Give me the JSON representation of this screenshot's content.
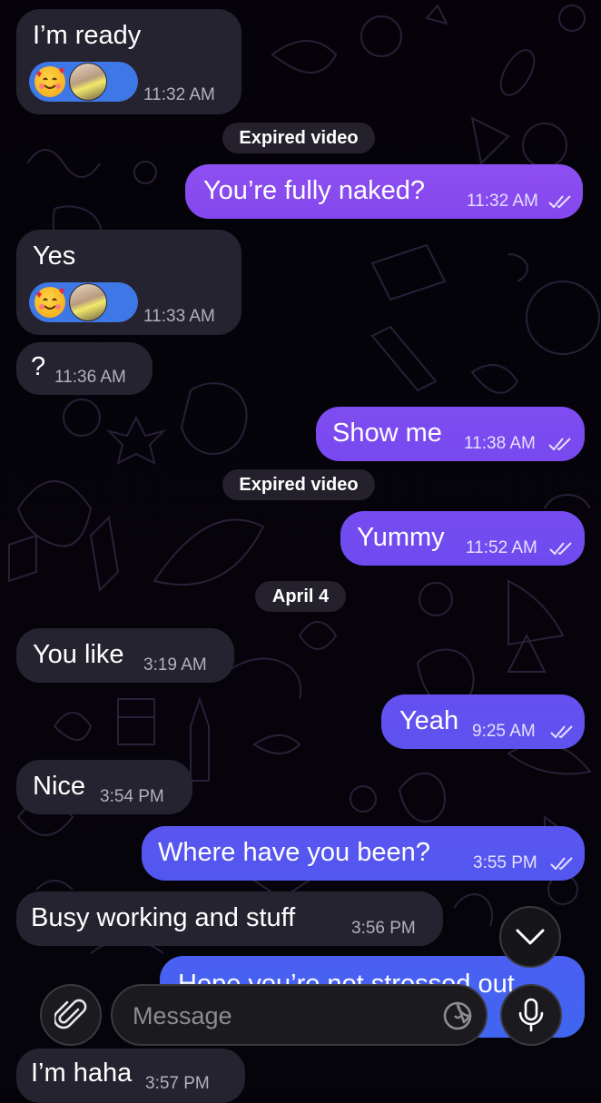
{
  "chat": {
    "messages": [
      {
        "id": "m1",
        "dir": "in",
        "text": "I’m ready",
        "time": "11:32 AM",
        "reactions": [
          "smiling-face-with-hearts",
          "sender-avatar"
        ]
      },
      {
        "id": "s1",
        "type": "service",
        "text": "Expired video"
      },
      {
        "id": "m2",
        "dir": "out",
        "text": "You’re fully naked?",
        "time": "11:32 AM",
        "read": true
      },
      {
        "id": "m3",
        "dir": "in",
        "text": "Yes",
        "time": "11:33 AM",
        "reactions": [
          "smiling-face-with-hearts",
          "sender-avatar"
        ]
      },
      {
        "id": "m4",
        "dir": "in",
        "text": "?",
        "time": "11:36 AM"
      },
      {
        "id": "m5",
        "dir": "out",
        "text": "Show me",
        "time": "11:38 AM",
        "read": true
      },
      {
        "id": "s2",
        "type": "service",
        "text": "Expired video"
      },
      {
        "id": "m6",
        "dir": "out",
        "text": "Yummy",
        "time": "11:52 AM",
        "read": true
      },
      {
        "id": "d1",
        "type": "date",
        "text": "April 4"
      },
      {
        "id": "m7",
        "dir": "in",
        "text": "You like",
        "time": "3:19 AM"
      },
      {
        "id": "m8",
        "dir": "out",
        "text": "Yeah",
        "time": "9:25 AM",
        "read": true
      },
      {
        "id": "m9",
        "dir": "in",
        "text": "Nice",
        "time": "3:54 PM"
      },
      {
        "id": "m10",
        "dir": "out",
        "text": "Where have you been?",
        "time": "3:55 PM",
        "read": true
      },
      {
        "id": "m11",
        "dir": "in",
        "text": "Busy working and stuff",
        "time": "3:56 PM"
      },
      {
        "id": "m12",
        "dir": "out",
        "text": "Hope you’re not stressed out",
        "time": "",
        "read": true
      },
      {
        "id": "m13",
        "dir": "in",
        "text": "I’m haha",
        "time": "3:57 PM"
      }
    ]
  },
  "input": {
    "placeholder": "Message",
    "attach_icon": "paperclip-icon",
    "sticker_icon": "sticker-icon",
    "mic_icon": "microphone-icon"
  },
  "scroll_down_icon": "chevron-down-icon",
  "colors": {
    "background": "#050309",
    "incoming_bubble": "#262330",
    "outgoing_gradient_top": "#8e4ff0",
    "outgoing_gradient_bottom": "#3f66f0",
    "reaction_pill": "#3e77e6"
  }
}
